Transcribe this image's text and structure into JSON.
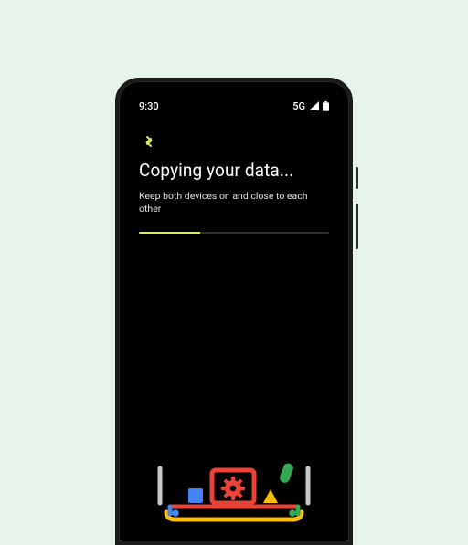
{
  "status": {
    "time": "9:30",
    "network_label": "5G"
  },
  "screen": {
    "heading": "Copying your data...",
    "subtext": "Keep both devices on and close to each other"
  },
  "progress": {
    "percent": 32
  },
  "colors": {
    "accent": "#d8ec6a",
    "red": "#ea4335",
    "blue": "#4285f4",
    "green": "#34a853",
    "yellow": "#fbbc04"
  }
}
